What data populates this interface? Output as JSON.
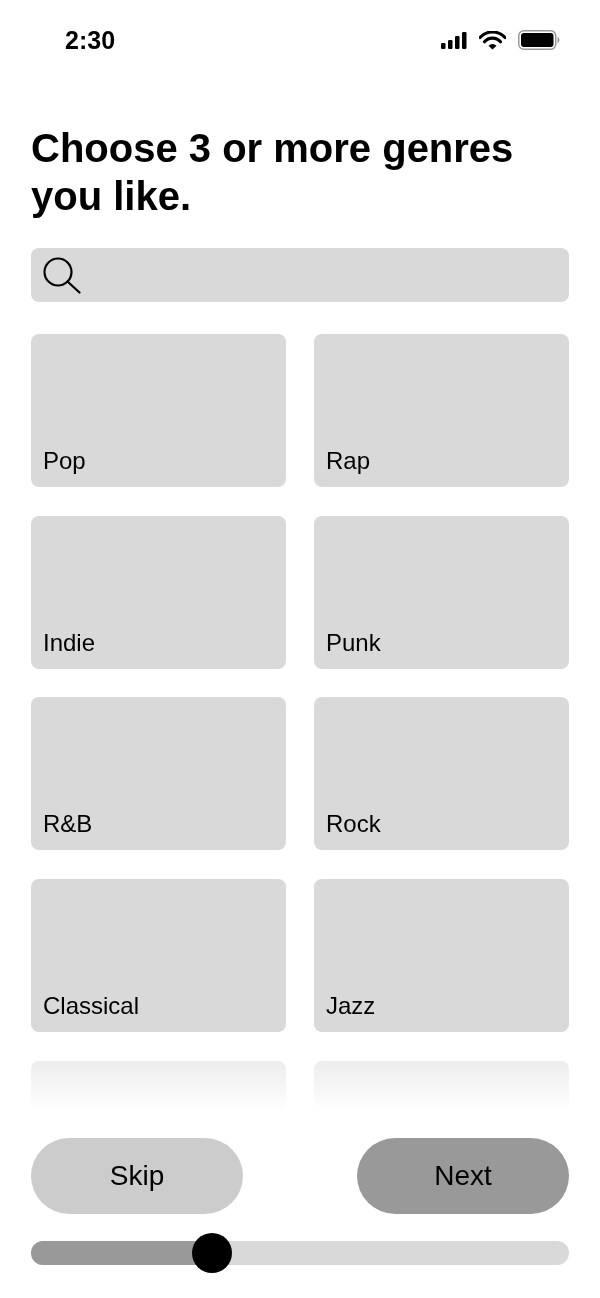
{
  "status_bar": {
    "time": "2:30"
  },
  "title": "Choose 3 or more genres you like.",
  "genres": [
    {
      "kind": "card",
      "label": "Pop",
      "selected": false
    },
    {
      "kind": "card",
      "label": "Rap",
      "selected": false
    },
    {
      "kind": "card",
      "label": "Indie",
      "selected": false
    },
    {
      "kind": "card",
      "label": "Punk",
      "selected": false
    },
    {
      "kind": "card",
      "label": "R&B",
      "selected": false
    },
    {
      "kind": "card",
      "label": "Rock",
      "selected": false
    },
    {
      "kind": "card",
      "label": "Classical",
      "selected": false
    },
    {
      "kind": "card",
      "label": "Jazz",
      "selected": false
    },
    {
      "kind": "faded",
      "selected": false
    },
    {
      "kind": "faded",
      "selected": false
    }
  ],
  "buttons": [
    {
      "kind": "secondary",
      "label": "Skip"
    },
    {
      "kind": "primary",
      "label": "Next"
    }
  ],
  "progress": {
    "level": 0.336
  }
}
